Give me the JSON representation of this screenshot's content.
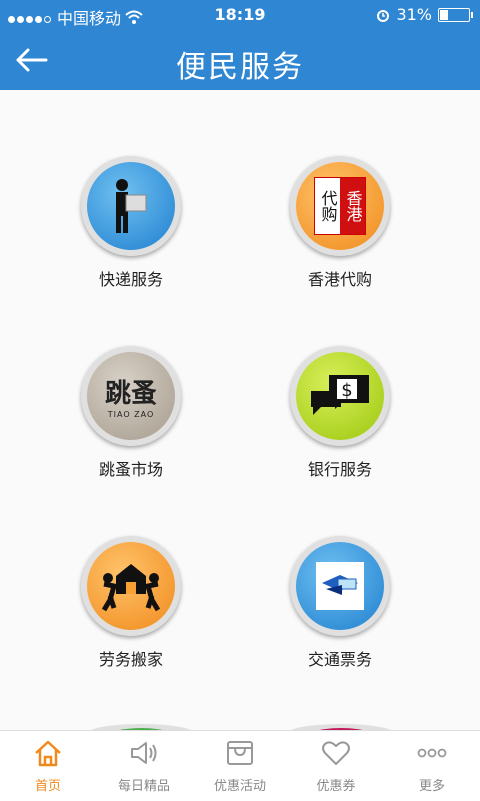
{
  "status_bar": {
    "carrier": "中国移动",
    "time": "18:19",
    "battery": "31%",
    "battery_level": 0.31
  },
  "header": {
    "title": "便民服务"
  },
  "services": [
    {
      "label": "快递服务",
      "icon": "courier-icon"
    },
    {
      "label": "香港代购",
      "icon": "hk-purchase-icon",
      "badge_left": "代购",
      "badge_right": "香港"
    },
    {
      "label": "跳蚤市场",
      "icon": "flea-market-icon",
      "logo_text": "跳蚤",
      "logo_sub": "TIAO ZAO"
    },
    {
      "label": "银行服务",
      "icon": "bank-icon",
      "symbol": "$"
    },
    {
      "label": "劳务搬家",
      "icon": "moving-icon"
    },
    {
      "label": "交通票务",
      "icon": "ticket-icon"
    }
  ],
  "tabs": [
    {
      "label": "首页",
      "icon": "home-icon",
      "active": true
    },
    {
      "label": "每日精品",
      "icon": "speaker-icon"
    },
    {
      "label": "优惠活动",
      "icon": "bag-icon"
    },
    {
      "label": "优惠券",
      "icon": "heart-icon"
    },
    {
      "label": "更多",
      "icon": "more-icon"
    }
  ],
  "colors": {
    "header": "#2f86d2",
    "active_tab": "#f08a1c"
  }
}
